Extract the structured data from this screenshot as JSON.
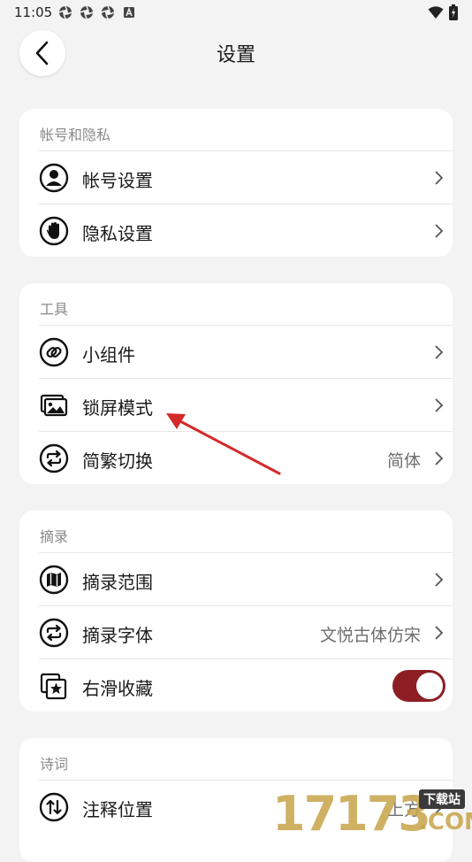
{
  "status_bar": {
    "time": "11:05",
    "notification_icons": [
      "aperture-icon",
      "aperture-icon",
      "aperture-icon",
      "a-badge-icon"
    ],
    "right_icons": [
      "wifi-icon",
      "battery-charging-icon"
    ]
  },
  "header": {
    "title": "设置",
    "back_icon": "chevron-left-icon"
  },
  "sections": [
    {
      "title": "帐号和隐私",
      "rows": [
        {
          "label": "帐号设置",
          "icon": "account-circle-icon",
          "control": "chevron"
        },
        {
          "label": "隐私设置",
          "icon": "hand-stop-icon",
          "control": "chevron"
        }
      ]
    },
    {
      "title": "工具",
      "rows": [
        {
          "label": "小组件",
          "icon": "link-icon",
          "control": "chevron"
        },
        {
          "label": "锁屏模式",
          "icon": "image-stack-icon",
          "control": "chevron"
        },
        {
          "label": "简繁切换",
          "icon": "swap-cycle-icon",
          "value": "简体",
          "control": "chevron"
        }
      ]
    },
    {
      "title": "摘录",
      "rows": [
        {
          "label": "摘录范围",
          "icon": "map-icon",
          "control": "chevron"
        },
        {
          "label": "摘录字体",
          "icon": "swap-cycle-icon",
          "value": "文悦古体仿宋",
          "control": "chevron"
        },
        {
          "label": "右滑收藏",
          "icon": "star-stack-icon",
          "control": "toggle",
          "toggle_on": true
        }
      ]
    },
    {
      "title": "诗词",
      "rows": [
        {
          "label": "注释位置",
          "icon": "swap-vertical-icon",
          "value": "上方",
          "control": "chevron"
        }
      ]
    }
  ],
  "colors": {
    "background": "#f4f3f3",
    "card": "#ffffff",
    "accent": "#8c1e24",
    "annotation_arrow": "#d42a2a"
  },
  "watermark": {
    "number": "17173",
    "tag": "下载站",
    "domain": ".COM"
  }
}
